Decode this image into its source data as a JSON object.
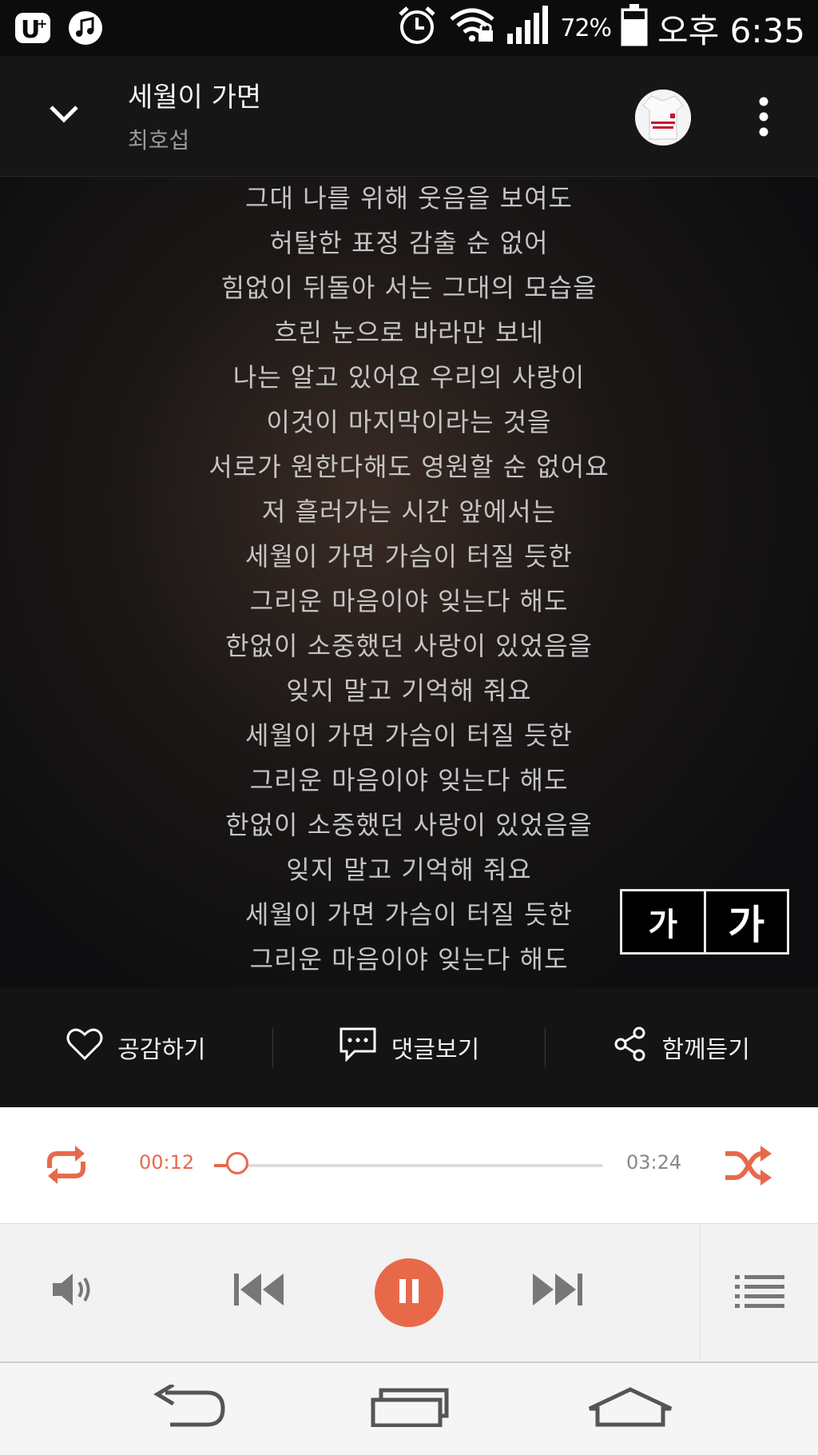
{
  "status_bar": {
    "battery_percent": "72%",
    "time": "오후 6:35",
    "icons": [
      "uplus-icon",
      "music-icon",
      "alarm-icon",
      "wifi-lock-icon",
      "signal-icon",
      "battery-icon"
    ]
  },
  "header": {
    "title": "세월이 가면",
    "artist": "최호섭"
  },
  "lyrics": [
    "그대 나를 위해 웃음을 보여도",
    "허탈한 표정 감출 순 없어",
    "힘없이 뒤돌아 서는 그대의 모습을",
    "흐린 눈으로 바라만 보네",
    "나는 알고 있어요 우리의 사랑이",
    "이것이 마지막이라는 것을",
    "서로가 원한다해도 영원할 순 없어요",
    "저 흘러가는 시간 앞에서는",
    "세월이 가면 가슴이 터질 듯한",
    "그리운 마음이야 잊는다 해도",
    "한없이 소중했던 사랑이 있었음을",
    "잊지 말고 기억해 줘요",
    "세월이 가면 가슴이 터질 듯한",
    "그리운 마음이야 잊는다 해도",
    "한없이 소중했던 사랑이 있었음을",
    "잊지 말고 기억해 줘요",
    "세월이 가면 가슴이 터질 듯한",
    "그리운 마음이야 잊는다 해도"
  ],
  "font_size_controls": {
    "small_label": "가",
    "large_label": "가"
  },
  "actions": {
    "like": "공감하기",
    "comments": "댓글보기",
    "listen_together": "함께듣기"
  },
  "player": {
    "current_time": "00:12",
    "total_time": "03:24",
    "progress_fraction": 0.059,
    "accent_color": "#e8694a"
  }
}
